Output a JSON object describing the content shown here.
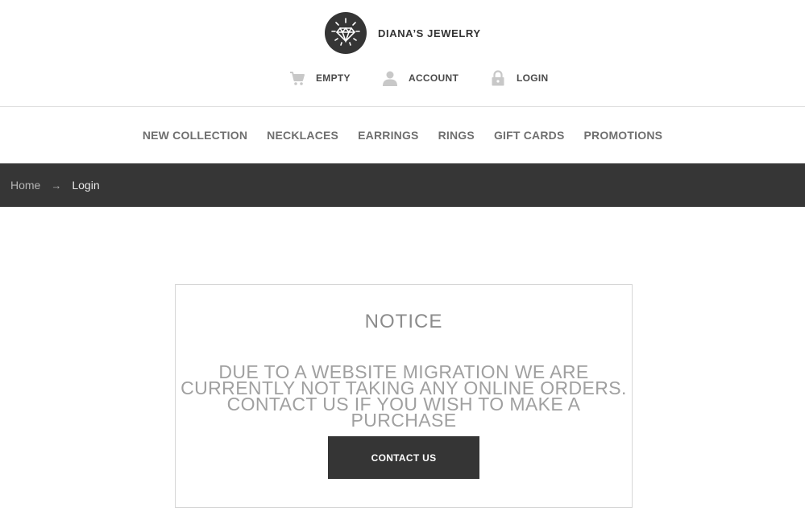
{
  "brand": {
    "name": "DIANA’S JEWELRY",
    "logo_icon": "diamond-icon"
  },
  "utility_nav": [
    {
      "id": "cart",
      "label": "EMPTY",
      "icon": "cart-icon"
    },
    {
      "id": "account",
      "label": "ACCOUNT",
      "icon": "user-icon"
    },
    {
      "id": "login",
      "label": "LOGIN",
      "icon": "lock-icon"
    }
  ],
  "main_nav": [
    {
      "label": "NEW COLLECTION"
    },
    {
      "label": "NECKLACES"
    },
    {
      "label": "EARRINGS"
    },
    {
      "label": "RINGS"
    },
    {
      "label": "GIFT CARDS"
    },
    {
      "label": "PROMOTIONS"
    }
  ],
  "breadcrumb": {
    "home": "Home",
    "separator": "→",
    "current": "Login"
  },
  "notice": {
    "title": "NOTICE",
    "body": "DUE TO A WEBSITE MIGRATION WE ARE CURRENTLY NOT TAKING ANY ONLINE ORDERS. CONTACT US IF YOU WISH TO MAKE A PURCHASE",
    "button_label": "CONTACT US"
  },
  "colors": {
    "dark": "#363636",
    "nav_text": "#6f6f6f",
    "notice_text": "#a0a0a0",
    "icon_gray": "#c8c8c8"
  }
}
